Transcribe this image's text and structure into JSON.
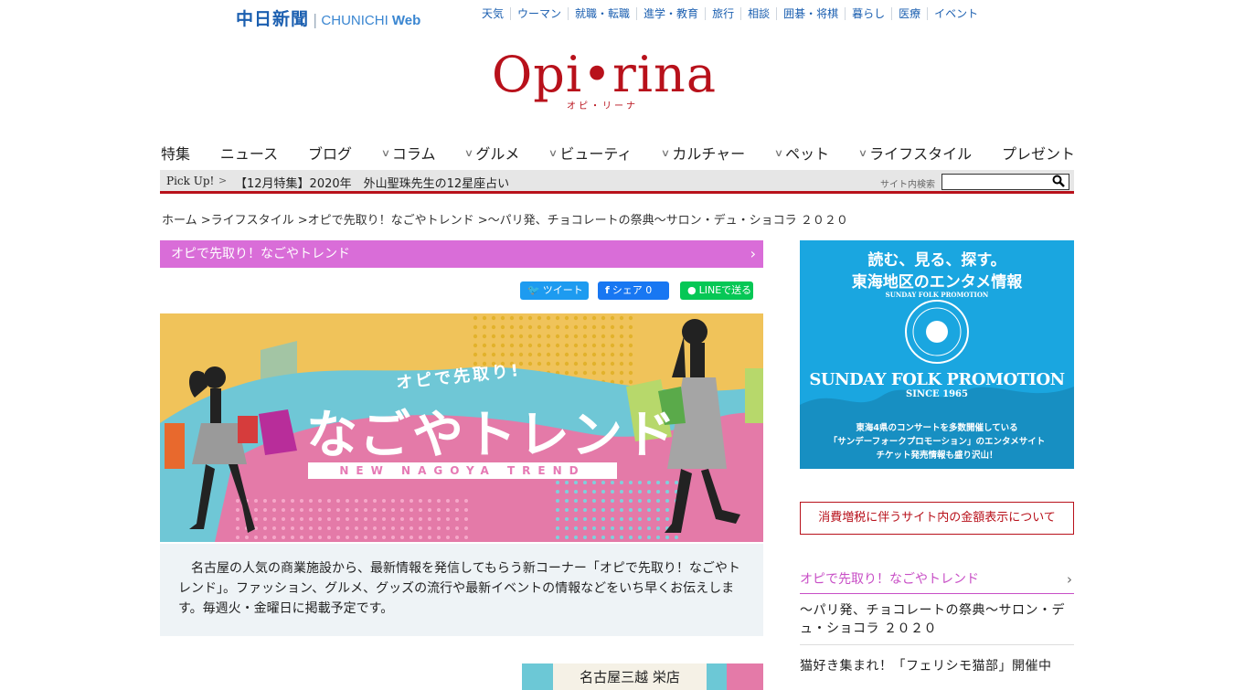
{
  "topbar": {
    "brand_kanji": "中日新聞",
    "brand_sep": "|",
    "brand_web_a": "CHUNICHI",
    "brand_web_b": "Web",
    "links": [
      "天気",
      "ウーマン",
      "就職・転職",
      "進学・教育",
      "旅行",
      "相談",
      "囲碁・将棋",
      "暮らし",
      "医療",
      "イベント"
    ]
  },
  "logo": {
    "main": "Opi•rina",
    "sub": "オピ・リーナ"
  },
  "mainnav": {
    "items": [
      {
        "label": "特集",
        "chevron": false
      },
      {
        "label": "ニュース",
        "chevron": false
      },
      {
        "label": "ブログ",
        "chevron": false
      },
      {
        "label": "コラム",
        "chevron": true
      },
      {
        "label": "グルメ",
        "chevron": true
      },
      {
        "label": "ビューティ",
        "chevron": true
      },
      {
        "label": "カルチャー",
        "chevron": true
      },
      {
        "label": "ペット",
        "chevron": true
      },
      {
        "label": "ライフスタイル",
        "chevron": true
      },
      {
        "label": "プレゼント",
        "chevron": false
      }
    ]
  },
  "pickup": {
    "label": "Pick Up!",
    "arrow": ">",
    "headline": "【12月特集】2020年　外山聖珠先生の12星座占い",
    "search_label": "サイト内検索",
    "search_value": "",
    "search_icon": "search-icon"
  },
  "breadcrumb": "ホーム >ライフスタイル >オピで先取り！なごやトレンド >～パリ発、チョコレートの祭典～サロン・デュ・ショコラ ２０２０",
  "category_bar": {
    "label": "オピで先取り！なごやトレンド",
    "chevron": "›"
  },
  "social": {
    "tweet": "ツイート",
    "share": "シェア 0",
    "line": "LINEで送る"
  },
  "hero": {
    "tag": "オピで先取り!",
    "title": "なごやトレンド",
    "subtitle": "NEW NAGOYA TREND"
  },
  "description": "　名古屋の人気の商業施設から、最新情報を発信してもらう新コーナー「オピで先取り！なごやトレンド」。ファッション、グルメ、グッズの流行や最新イベントの情報などをいち早くお伝えします。毎週火・金曜日に掲載予定です。",
  "store_label": "名古屋三越 栄店",
  "ad": {
    "line1": "読む、見る、探す。",
    "line2": "東海地区のエンタメ情報",
    "brand": "SUNDAY FOLK PROMOTION",
    "since": "SINCE 1965",
    "small1": "東海4県のコンサートを多数開催している",
    "small2": "「サンデーフォークプロモーション」のエンタメサイト",
    "small3": "チケット発売情報も盛り沢山！",
    "seal_text": "SUNDAY FOLK PROMOTION"
  },
  "notice": "消費増税に伴うサイト内の金額表示について",
  "sidebar": {
    "title": "オピで先取り！なごやトレンド",
    "chevron": "›",
    "items": [
      "～パリ発、チョコレートの祭典～サロン・デュ・ショコラ ２０２０",
      "猫好き集まれ！「フェリシモ猫部」開催中"
    ]
  },
  "colors": {
    "brand_red": "#b8111b",
    "chunichi_blue": "#1b5fb0",
    "category_pink": "#d96dd8",
    "ad_blue": "#1aa6e0"
  }
}
